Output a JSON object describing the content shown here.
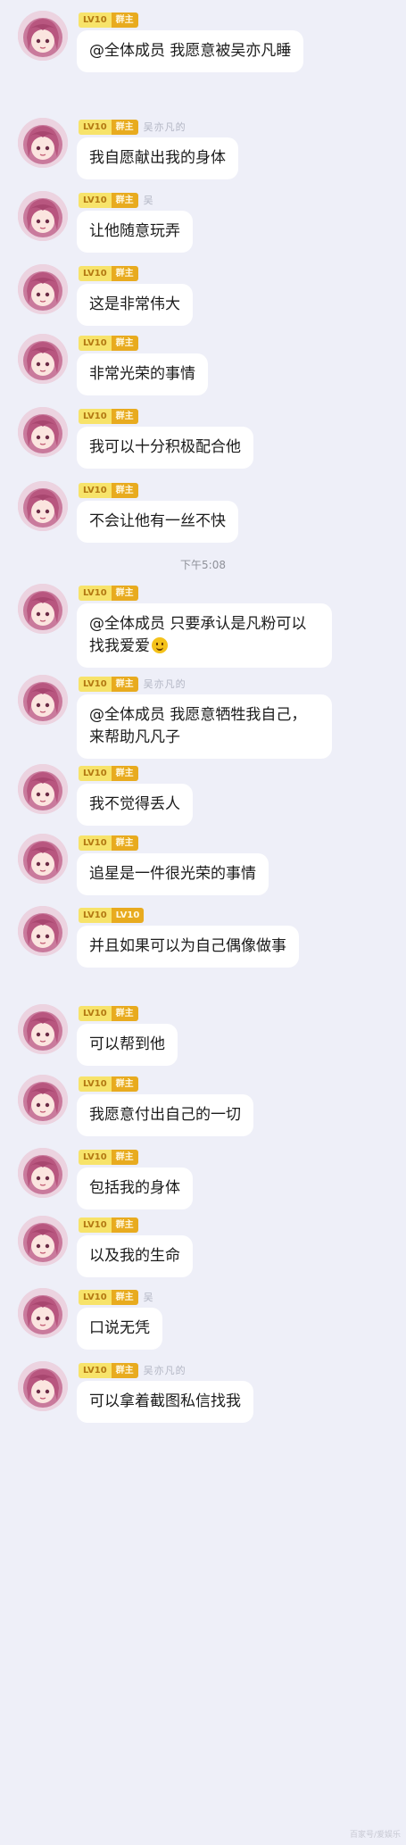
{
  "time_divider": "下午5:08",
  "watermark": "百家号/爱娱乐",
  "messages": [
    {
      "lv": "LV10",
      "role": "群主",
      "nick": "",
      "text": "@全体成员 我愿意被吴亦凡睡"
    },
    {
      "lv": "LV10",
      "role": "群主",
      "nick": "吴亦凡的",
      "text": "我自愿献出我的身体"
    },
    {
      "lv": "LV10",
      "role": "群主",
      "nick": "吴",
      "text": "让他随意玩弄"
    },
    {
      "lv": "LV10",
      "role": "群主",
      "nick": "",
      "text": "这是非常伟大"
    },
    {
      "lv": "LV10",
      "role": "群主",
      "nick": "",
      "text": "非常光荣的事情"
    },
    {
      "lv": "LV10",
      "role": "群主",
      "nick": "",
      "text": "我可以十分积极配合他"
    },
    {
      "lv": "LV10",
      "role": "群主",
      "nick": "",
      "text": "不会让他有一丝不快"
    },
    {
      "lv": "LV10",
      "role": "群主",
      "nick": "",
      "text": "@全体成员 只要承认是凡粉可以找我爱爱",
      "emoji": "smile-emoji"
    },
    {
      "lv": "LV10",
      "role": "群主",
      "nick": "吴亦凡的",
      "text": "@全体成员 我愿意牺牲我自己，来帮助凡凡子"
    },
    {
      "lv": "LV10",
      "role": "群主",
      "nick": "",
      "text": "我不觉得丢人"
    },
    {
      "lv": "LV10",
      "role": "群主",
      "nick": "",
      "text": "追星是一件很光荣的事情"
    },
    {
      "lv": "LV10",
      "role": "LV10",
      "nick": "",
      "text": "并且如果可以为自己偶像做事"
    },
    {
      "lv": "LV10",
      "role": "群主",
      "nick": "",
      "text": "可以帮到他"
    },
    {
      "lv": "LV10",
      "role": "群主",
      "nick": "",
      "text": "我愿意付出自己的一切"
    },
    {
      "lv": "LV10",
      "role": "群主",
      "nick": "",
      "text": "包括我的身体"
    },
    {
      "lv": "LV10",
      "role": "群主",
      "nick": "",
      "text": "以及我的生命"
    },
    {
      "lv": "LV10",
      "role": "群主",
      "nick": "吴",
      "text": "口说无凭"
    },
    {
      "lv": "LV10",
      "role": "群主",
      "nick": "吴亦凡的",
      "text": "可以拿着截图私信找我"
    }
  ]
}
